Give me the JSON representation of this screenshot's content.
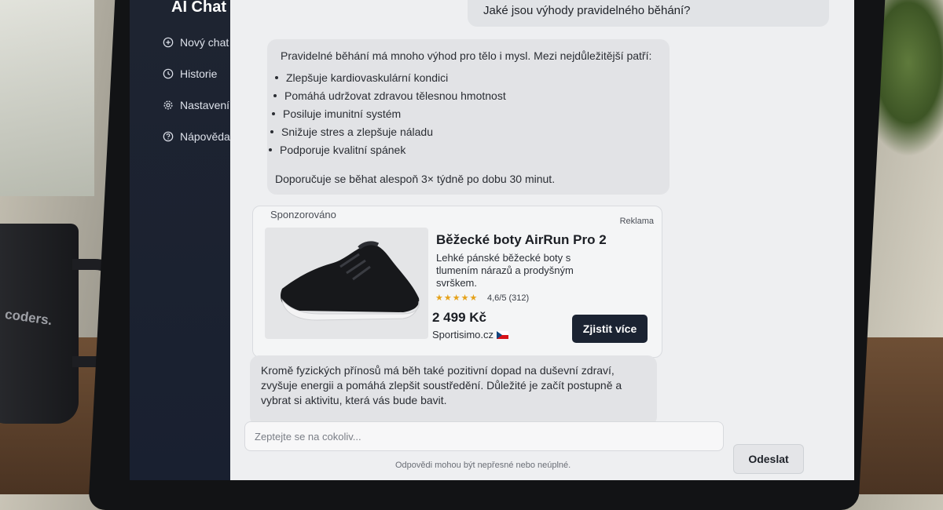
{
  "sidebar": {
    "brand": "AI Chat",
    "items": [
      {
        "label": "Nový chat",
        "icon": "plus-circle-icon"
      },
      {
        "label": "Historie",
        "icon": "clock-icon"
      },
      {
        "label": "Nastavení",
        "icon": "gear-icon"
      },
      {
        "label": "Nápověda",
        "icon": "help-circle-icon"
      }
    ]
  },
  "conversation": {
    "user_message": "Jaké jsou výhody pravidelného běhání?",
    "reply1": {
      "intro": "Pravidelné běhání má mnoho výhod pro tělo i mysl. Mezi nejdůležitější patří:",
      "benefits": [
        "Zlepšuje kardiovaskulární kondici",
        "Pomáhá udržovat zdravou tělesnou hmotnost",
        "Posiluje imunitní systém",
        "Snižuje stres a zlepšuje náladu",
        "Podporuje kvalitní spánek"
      ],
      "outro": "Doporučuje se běhat alespoň 3× týdně po dobu 30 minut."
    },
    "reply2": "Kromě fyzických přínosů má běh také pozitivní dopad na duševní zdraví, zvyšuje energii a pomáhá zlepšit soustředění. Důležité je začít postupně a vybrat si aktivitu, která vás bude bavit."
  },
  "ad": {
    "sponsored_label": "Sponzorováno",
    "tag": "Reklama",
    "title": "Běžecké boty AirRun Pro 2",
    "description": "Lehké pánské běžecké boty s tlumením nárazů a prodyšným svrškem.",
    "stars": "★★★★★",
    "rating": 4.6,
    "rating_text": "4,6/5 (312)",
    "price": "2 499 Kč",
    "shop": "Sportisimo.cz",
    "cta": "Zjistit více"
  },
  "composer": {
    "placeholder": "Zeptejte se na cokoliv...",
    "send_label": "Odeslat",
    "disclaimer": "Odpovědi mohou být nepřesné nebo neúplné."
  },
  "background": {
    "mug_text": "coders."
  }
}
